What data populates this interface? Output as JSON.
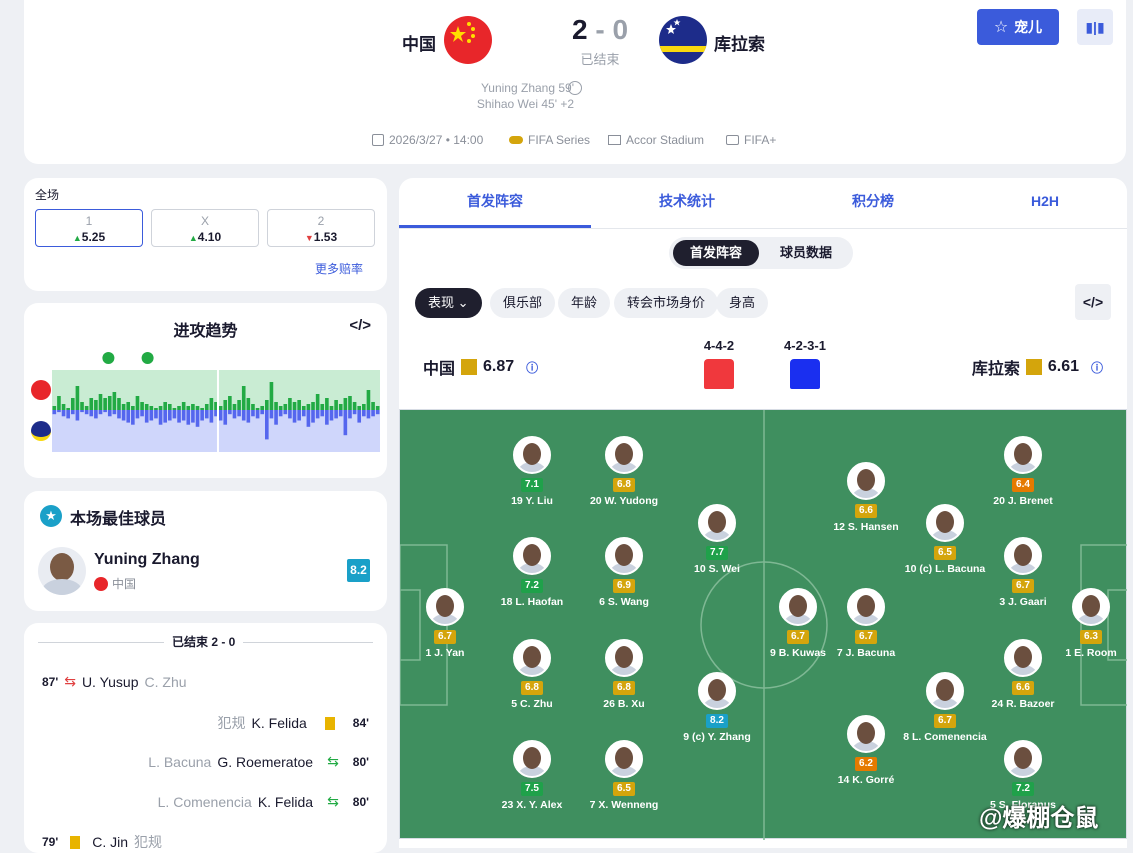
{
  "header": {
    "home_team": "中国",
    "away_team": "库拉索",
    "score_home": "2",
    "score_sep": "-",
    "score_away": "0",
    "status": "已结束",
    "scorers": [
      "Yuning Zhang 59'",
      "Shihao Wei 45' +2"
    ],
    "date": "2026/3/27 • 14:00",
    "competition": "FIFA Series",
    "venue": "Accor Stadium",
    "broadcast": "FIFA+",
    "favorite_label": "宠儿"
  },
  "odds": {
    "title": "全场",
    "items": [
      {
        "label": "1",
        "value": "5.25",
        "dir": "up"
      },
      {
        "label": "X",
        "value": "4.10",
        "dir": "up"
      },
      {
        "label": "2",
        "value": "1.53",
        "dir": "down"
      }
    ],
    "more": "更多赔率"
  },
  "momentum": {
    "title": "进攻趋势",
    "home_values": [
      0.1,
      0.35,
      0.15,
      0.05,
      0.3,
      0.6,
      0.2,
      0.1,
      0.3,
      0.25,
      0.4,
      0.3,
      0.35,
      0.45,
      0.3,
      0.15,
      0.2,
      0.1,
      0.35,
      0.2,
      0.15,
      0.1,
      0.05,
      0.1,
      0.2,
      0.15,
      0.05,
      0.1,
      0.2,
      0.1,
      0.15,
      0.1,
      0.05,
      0.15,
      0.3,
      0.2,
      0.1,
      0.25,
      0.35,
      0.15,
      0.25,
      0.6,
      0.3,
      0.15,
      0.05,
      0.1,
      0.25,
      0.7,
      0.2,
      0.1,
      0.15,
      0.3,
      0.2,
      0.25,
      0.1,
      0.15,
      0.2,
      0.4,
      0.15,
      0.3,
      0.1,
      0.25,
      0.15,
      0.3,
      0.35,
      0.2,
      0.1,
      0.15,
      0.5,
      0.2,
      0.1
    ],
    "away_values": [
      0.1,
      0.05,
      0.15,
      0.2,
      0.1,
      0.25,
      0.05,
      0.1,
      0.15,
      0.2,
      0.1,
      0.05,
      0.15,
      0.1,
      0.2,
      0.25,
      0.3,
      0.35,
      0.2,
      0.15,
      0.3,
      0.25,
      0.2,
      0.35,
      0.3,
      0.25,
      0.2,
      0.3,
      0.25,
      0.35,
      0.3,
      0.4,
      0.25,
      0.2,
      0.3,
      0.15,
      0.25,
      0.35,
      0.1,
      0.2,
      0.15,
      0.25,
      0.3,
      0.15,
      0.2,
      0.1,
      0.7,
      0.2,
      0.35,
      0.15,
      0.1,
      0.2,
      0.3,
      0.25,
      0.15,
      0.4,
      0.3,
      0.2,
      0.15,
      0.35,
      0.25,
      0.2,
      0.15,
      0.6,
      0.2,
      0.1,
      0.3,
      0.15,
      0.2,
      0.15,
      0.1
    ],
    "goal_markers": [
      0.55,
      0.7
    ],
    "colors": {
      "home": "#22aa44",
      "away": "#5566ee",
      "home_bg": "#c9ecd3",
      "away_bg": "#cfd6fb"
    }
  },
  "best_player": {
    "title": "本场最佳球员",
    "name": "Yuning Zhang",
    "team": "中国",
    "rating": "8.2"
  },
  "events": {
    "header": "已结束 2 - 0",
    "rows": [
      {
        "minute": "87'",
        "type": "sub",
        "main": "U. Yusup",
        "sub": "C. Zhu",
        "side": "home"
      },
      {
        "minute": "84'",
        "type": "yellow",
        "label": "犯规",
        "main": "K. Felida",
        "side": "away"
      },
      {
        "minute": "80'",
        "type": "sub",
        "sub": "L. Bacuna",
        "main": "G. Roemeratoe",
        "side": "away"
      },
      {
        "minute": "80'",
        "type": "sub",
        "sub": "L. Comenencia",
        "main": "K. Felida",
        "side": "away"
      },
      {
        "minute": "79'",
        "type": "yellow",
        "main": "C. Jin",
        "label": "犯规",
        "side": "home"
      }
    ]
  },
  "lineup": {
    "tabs": [
      "首发阵容",
      "技术统计",
      "积分榜",
      "H2H"
    ],
    "subtabs": [
      "首发阵容",
      "球员数据"
    ],
    "chips": [
      "表现",
      "俱乐部",
      "年龄",
      "转会市场身价",
      "身高"
    ],
    "home_name": "中国",
    "home_rating": "6.87",
    "away_name": "库拉索",
    "away_rating": "6.61",
    "home_formation": "4-4-2",
    "away_formation": "4-2-3-1",
    "home_color": "#f0383d",
    "away_color": "#1a2ff0",
    "watermark": "@爆棚仓鼠"
  },
  "players": [
    {
      "name": "1 J. Yan",
      "rating": "6.7",
      "c": "#d4a50c"
    },
    {
      "name": "19 Y. Liu",
      "rating": "7.1",
      "c": "#1fa14a"
    },
    {
      "name": "18 L. Haofan",
      "rating": "7.2",
      "c": "#1fa14a"
    },
    {
      "name": "5 C. Zhu",
      "rating": "6.8",
      "c": "#d4a50c"
    },
    {
      "name": "23 X. Y. Alex",
      "rating": "7.5",
      "c": "#1fa14a"
    },
    {
      "name": "20 W. Yudong",
      "rating": "6.8",
      "c": "#d4a50c"
    },
    {
      "name": "6 S. Wang",
      "rating": "6.9",
      "c": "#d4a50c"
    },
    {
      "name": "26 B. Xu",
      "rating": "6.8",
      "c": "#d4a50c"
    },
    {
      "name": "7 X. Wenneng",
      "rating": "6.5",
      "c": "#d4a50c"
    },
    {
      "name": "10 S. Wei",
      "rating": "7.7",
      "c": "#1fa14a"
    },
    {
      "name": "9 (c) Y. Zhang",
      "rating": "8.2",
      "c": "#1aa0c8"
    },
    {
      "name": "1 E. Room",
      "rating": "6.3",
      "c": "#d4a50c"
    },
    {
      "name": "20 J. Brenet",
      "rating": "6.4",
      "c": "#e57a00"
    },
    {
      "name": "3 J. Gaari",
      "rating": "6.7",
      "c": "#d4a50c"
    },
    {
      "name": "24 R. Bazoer",
      "rating": "6.6",
      "c": "#d4a50c"
    },
    {
      "name": "5 S. Floranus",
      "rating": "7.2",
      "c": "#1fa14a"
    },
    {
      "name": "10 (c) L. Bacuna",
      "rating": "6.5",
      "c": "#d4a50c"
    },
    {
      "name": "8 L. Comenencia",
      "rating": "6.7",
      "c": "#d4a50c"
    },
    {
      "name": "12 S. Hansen",
      "rating": "6.6",
      "c": "#d4a50c"
    },
    {
      "name": "7 J. Bacuna",
      "rating": "6.7",
      "c": "#d4a50c"
    },
    {
      "name": "14 K. Gorré",
      "rating": "6.2",
      "c": "#e57a00"
    },
    {
      "name": "9 B. Kuwas",
      "rating": "6.7",
      "c": "#d4a50c"
    }
  ]
}
